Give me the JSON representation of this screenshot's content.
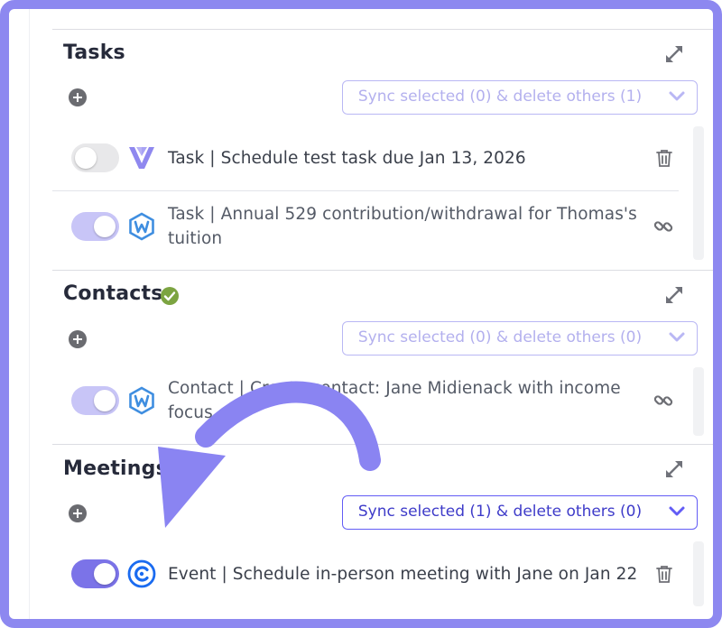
{
  "sections": [
    {
      "title": "Tasks",
      "has_check": false,
      "sync_label": "Sync selected (0) & delete others (1)",
      "sync_active": false,
      "items": [
        {
          "text": "Task | Schedule test task due Jan 13, 2026",
          "toggle": "off",
          "app_icon": "wealthbox-v-icon",
          "action": "trash-icon"
        },
        {
          "text": "Task | Annual 529 contribution/withdrawal for Thomas's tuition",
          "toggle": "on-disabled",
          "app_icon": "wealthbox-w-icon",
          "action": "link-icon"
        }
      ]
    },
    {
      "title": "Contacts",
      "has_check": true,
      "sync_label": "Sync selected (0) & delete others (0)",
      "sync_active": false,
      "items": [
        {
          "text": "Contact | Create contact: Jane Midienack with income focus",
          "toggle": "on-disabled",
          "app_icon": "wealthbox-w-icon",
          "action": "link-icon"
        }
      ]
    },
    {
      "title": "Meetings",
      "has_check": false,
      "sync_label": "Sync selected (1) & delete others (0)",
      "sync_active": true,
      "items": [
        {
          "text": "Event | Schedule in-person meeting with Jane on Jan 22",
          "toggle": "on",
          "app_icon": "calendly-icon",
          "action": "trash-icon"
        }
      ]
    }
  ],
  "icons": {
    "expand": "expand-arrows-icon",
    "add": "plus-circle-icon",
    "dropdown": "chevron-down-icon",
    "check": "check-circle-icon",
    "annotation": "curved-arrow-icon"
  },
  "colors": {
    "frame": "#8d88f0",
    "annotation_arrow": "#8a84f2",
    "sync_active_border": "#625cf5",
    "sync_active_text": "#3e3bc9",
    "sync_inactive_text": "#b3b0ee",
    "toggle_on": "#7b73e8",
    "toggle_dim": "#c8c5f7",
    "check_green": "#7ca441",
    "wealthbox_blue": "#3f8ee0",
    "calendly_blue": "#1a6bf0"
  }
}
